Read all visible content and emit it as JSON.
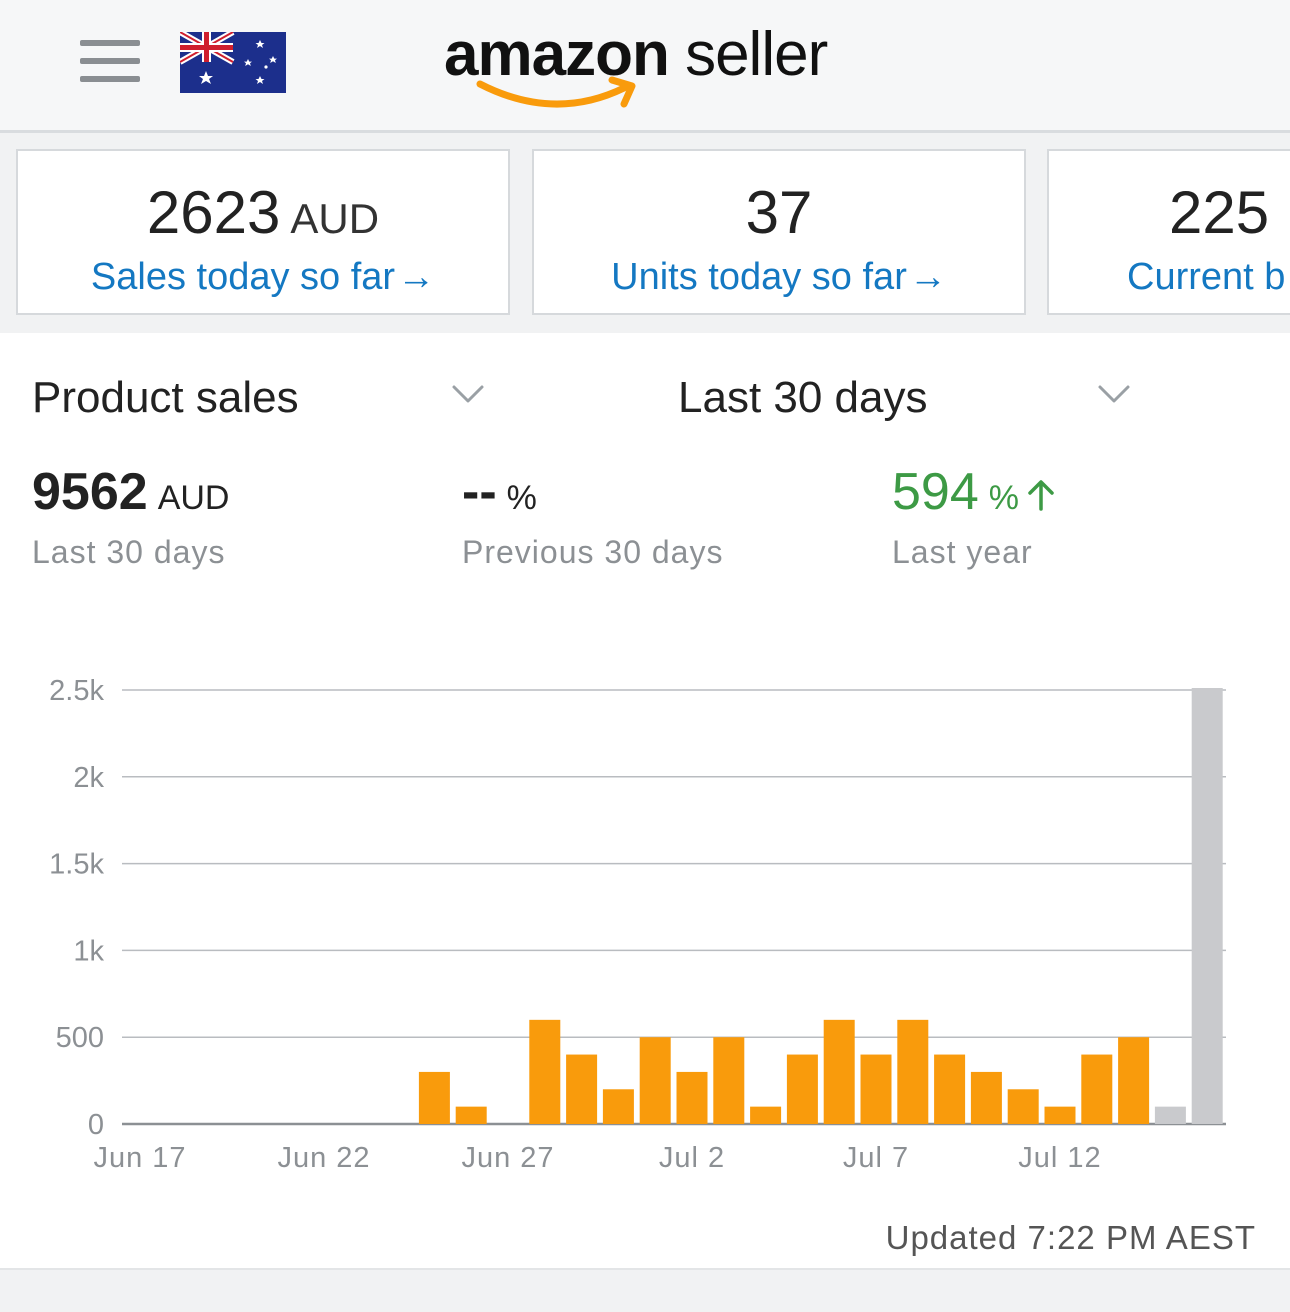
{
  "header": {
    "menu_icon": "hamburger-menu-icon",
    "flag_icon": "australia-flag-icon",
    "logo_bold": "amazon",
    "logo_light": "seller"
  },
  "cards": [
    {
      "value": "2623",
      "unit": "AUD",
      "label": "Sales today so far",
      "arrow": "→"
    },
    {
      "value": "37",
      "unit": "",
      "label": "Units today so far",
      "arrow": "→"
    },
    {
      "value": "225",
      "unit": "",
      "label": "Current b",
      "arrow": ""
    }
  ],
  "selectors": {
    "metric": "Product sales",
    "range": "Last 30 days",
    "chevron_icon": "chevron-down-icon"
  },
  "stats": {
    "current": {
      "value": "9562",
      "unit": "AUD",
      "label": "Last 30 days"
    },
    "previous": {
      "value": "--",
      "unit": "%",
      "label": "Previous 30 days"
    },
    "last_year": {
      "value": "594",
      "unit": "%",
      "label": "Last year",
      "trend_icon": "arrow-up-icon"
    }
  },
  "colors": {
    "accent_orange": "#f99b0c",
    "partial_day_gray": "#c9cacd",
    "link_blue": "#1478c2",
    "positive_green": "#3d9a45"
  },
  "chart_data": {
    "type": "bar",
    "title": "",
    "xlabel": "",
    "ylabel": "",
    "ylim": [
      0,
      2500
    ],
    "yticks": [
      0,
      500,
      1000,
      1500,
      2000,
      2500
    ],
    "ytick_labels": [
      "0",
      "500",
      "1k",
      "1.5k",
      "2k",
      "2.5k"
    ],
    "xtick_labels": [
      "Jun 17",
      "Jun 22",
      "Jun 27",
      "Jul 2",
      "Jul 7",
      "Jul 12"
    ],
    "grid": true,
    "categories": [
      "Jun 17",
      "Jun 18",
      "Jun 19",
      "Jun 20",
      "Jun 21",
      "Jun 22",
      "Jun 23",
      "Jun 24",
      "Jun 25",
      "Jun 26",
      "Jun 27",
      "Jun 28",
      "Jun 29",
      "Jun 30",
      "Jul 1",
      "Jul 2",
      "Jul 3",
      "Jul 4",
      "Jul 5",
      "Jul 6",
      "Jul 7",
      "Jul 8",
      "Jul 9",
      "Jul 10",
      "Jul 11",
      "Jul 12",
      "Jul 13",
      "Jul 14",
      "Jul 15",
      "Jul 16",
      "Jul 17"
    ],
    "series": [
      {
        "values": [
          0,
          0,
          0,
          0,
          0,
          0,
          0,
          0,
          300,
          100,
          0,
          600,
          400,
          200,
          500,
          300,
          500,
          100,
          400,
          600,
          400,
          600,
          400,
          300,
          200,
          100,
          400,
          500,
          100,
          2623,
          0
        ],
        "colors": [
          "orange",
          "orange",
          "orange",
          "orange",
          "orange",
          "orange",
          "orange",
          "orange",
          "orange",
          "orange",
          "orange",
          "orange",
          "orange",
          "orange",
          "orange",
          "orange",
          "orange",
          "orange",
          "orange",
          "orange",
          "orange",
          "orange",
          "orange",
          "orange",
          "orange",
          "orange",
          "orange",
          "orange",
          "gray",
          "gray",
          "gray"
        ]
      }
    ]
  },
  "footer": {
    "updated": "Updated 7:22 PM AEST"
  }
}
